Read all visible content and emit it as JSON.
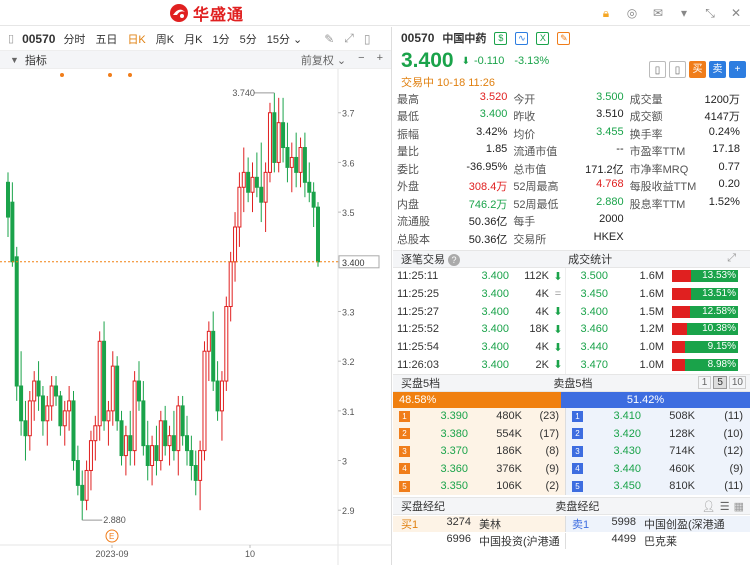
{
  "app": {
    "logo_text": "华盛通"
  },
  "chart_toolbar": {
    "code": "00570",
    "tabs": [
      "分时",
      "五日",
      "日K",
      "周K",
      "月K",
      "1分",
      "5分"
    ],
    "active_tab": "日K",
    "interval": "15分 ⌄"
  },
  "indicator_bar": {
    "label": "指标",
    "adjust": "前复权 ⌄",
    "minus": "−",
    "plus": "+"
  },
  "chart_data": {
    "type": "candlestick",
    "title": "",
    "xlabel": "",
    "ylabel": "",
    "x_ticks": [
      "2023-09",
      "10"
    ],
    "y_ticks": [
      2.9,
      3.0,
      3.1,
      3.2,
      3.3,
      3.4,
      3.5,
      3.6,
      3.7
    ],
    "ylim": [
      2.83,
      3.78
    ],
    "high_label": "3.740",
    "low_label": "2.880",
    "current_label": "3.400",
    "event_marker": "E",
    "candles": [
      [
        3.56,
        3.58,
        3.45,
        3.49
      ],
      [
        3.52,
        3.56,
        3.39,
        3.4
      ],
      [
        3.41,
        3.43,
        3.12,
        3.15
      ],
      [
        3.15,
        3.22,
        3.05,
        3.08
      ],
      [
        3.08,
        3.12,
        3.0,
        3.05
      ],
      [
        3.05,
        3.14,
        3.02,
        3.12
      ],
      [
        3.12,
        3.18,
        3.08,
        3.16
      ],
      [
        3.16,
        3.2,
        3.1,
        3.13
      ],
      [
        3.13,
        3.15,
        3.05,
        3.08
      ],
      [
        3.08,
        3.13,
        3.03,
        3.11
      ],
      [
        3.11,
        3.17,
        3.08,
        3.15
      ],
      [
        3.15,
        3.17,
        3.11,
        3.13
      ],
      [
        3.13,
        3.14,
        3.05,
        3.07
      ],
      [
        3.07,
        3.12,
        3.03,
        3.1
      ],
      [
        3.1,
        3.15,
        3.06,
        3.12
      ],
      [
        3.12,
        3.14,
        2.98,
        3.0
      ],
      [
        3.0,
        3.03,
        2.93,
        2.95
      ],
      [
        2.95,
        2.98,
        2.88,
        2.92
      ],
      [
        2.92,
        3.0,
        2.9,
        2.98
      ],
      [
        2.98,
        3.06,
        2.94,
        3.04
      ],
      [
        3.04,
        3.09,
        3.0,
        3.07
      ],
      [
        3.07,
        3.26,
        3.04,
        3.24
      ],
      [
        3.24,
        3.28,
        3.06,
        3.08
      ],
      [
        3.08,
        3.12,
        3.03,
        3.1
      ],
      [
        3.1,
        3.22,
        3.07,
        3.19
      ],
      [
        3.19,
        3.21,
        3.06,
        3.08
      ],
      [
        3.08,
        3.1,
        2.99,
        3.01
      ],
      [
        3.01,
        3.07,
        2.97,
        3.05
      ],
      [
        3.05,
        3.1,
        2.99,
        3.02
      ],
      [
        3.02,
        3.18,
        2.99,
        3.16
      ],
      [
        3.16,
        3.2,
        3.1,
        3.12
      ],
      [
        3.12,
        3.16,
        3.01,
        3.03
      ],
      [
        3.03,
        3.08,
        2.96,
        2.99
      ],
      [
        2.99,
        3.05,
        2.95,
        3.03
      ],
      [
        3.03,
        3.07,
        2.97,
        3.0
      ],
      [
        3.0,
        3.1,
        2.98,
        3.08
      ],
      [
        3.08,
        3.11,
        3.01,
        3.03
      ],
      [
        3.03,
        3.07,
        2.99,
        3.05
      ],
      [
        3.05,
        3.1,
        3.0,
        3.02
      ],
      [
        3.02,
        3.13,
        2.97,
        3.11
      ],
      [
        3.11,
        3.13,
        3.03,
        3.05
      ],
      [
        3.05,
        3.09,
        2.99,
        3.02
      ],
      [
        3.02,
        3.05,
        2.96,
        2.99
      ],
      [
        2.99,
        3.02,
        2.93,
        2.96
      ],
      [
        2.96,
        3.04,
        2.9,
        3.02
      ],
      [
        3.02,
        3.24,
        3.0,
        3.22
      ],
      [
        3.22,
        3.28,
        3.16,
        3.26
      ],
      [
        3.26,
        3.3,
        3.14,
        3.16
      ],
      [
        3.16,
        3.2,
        3.08,
        3.1
      ],
      [
        3.1,
        3.18,
        3.04,
        3.16
      ],
      [
        3.16,
        3.33,
        3.14,
        3.31
      ],
      [
        3.31,
        3.42,
        3.28,
        3.4
      ],
      [
        3.4,
        3.5,
        3.36,
        3.47
      ],
      [
        3.47,
        3.58,
        3.43,
        3.55
      ],
      [
        3.55,
        3.63,
        3.5,
        3.58
      ],
      [
        3.58,
        3.61,
        3.52,
        3.54
      ],
      [
        3.54,
        3.6,
        3.5,
        3.57
      ],
      [
        3.57,
        3.62,
        3.53,
        3.55
      ],
      [
        3.55,
        3.64,
        3.48,
        3.52
      ],
      [
        3.52,
        3.6,
        3.46,
        3.58
      ],
      [
        3.58,
        3.72,
        3.56,
        3.7
      ],
      [
        3.7,
        3.74,
        3.58,
        3.6
      ],
      [
        3.6,
        3.73,
        3.58,
        3.68
      ],
      [
        3.68,
        3.73,
        3.6,
        3.63
      ],
      [
        3.63,
        3.68,
        3.56,
        3.59
      ],
      [
        3.59,
        3.64,
        3.54,
        3.61
      ],
      [
        3.61,
        3.66,
        3.55,
        3.58
      ],
      [
        3.58,
        3.65,
        3.55,
        3.63
      ],
      [
        3.63,
        3.66,
        3.53,
        3.56
      ],
      [
        3.56,
        3.6,
        3.52,
        3.54
      ],
      [
        3.54,
        3.56,
        3.47,
        3.51
      ],
      [
        3.51,
        3.52,
        3.39,
        3.4
      ]
    ]
  },
  "quote": {
    "code": "00570",
    "name": "中国中药",
    "price": "3.400",
    "arrow": "⬇",
    "change": "-0.110",
    "change_pct": "-3.13%",
    "status": "交易中 10-18 11:26",
    "buttons": [
      "▯",
      "▯",
      "买",
      "卖",
      "+"
    ],
    "rows": [
      [
        [
          "最高",
          "3.520",
          "red"
        ],
        [
          "今开",
          "3.500",
          "green"
        ],
        [
          "成交量",
          "1200万",
          "blk"
        ]
      ],
      [
        [
          "最低",
          "3.400",
          "green"
        ],
        [
          "昨收",
          "3.510",
          "blk"
        ],
        [
          "成交额",
          "4147万",
          "blk"
        ]
      ],
      [
        [
          "振幅",
          "3.42%",
          "blk"
        ],
        [
          "均价",
          "3.455",
          "green"
        ],
        [
          "换手率",
          "0.24%",
          "blk"
        ]
      ],
      [
        [
          "量比",
          "1.85",
          "blk"
        ],
        [
          "流通市值",
          "--",
          "blk"
        ],
        [
          "市盈率TTM",
          "17.18",
          "blk"
        ]
      ],
      [
        [
          "委比",
          "-36.95%",
          "blk"
        ],
        [
          "总市值",
          "171.2亿",
          "blk"
        ],
        [
          "市净率MRQ",
          "0.77",
          "blk"
        ]
      ],
      [
        [
          "外盘",
          "308.4万",
          "red"
        ],
        [
          "52周最高",
          "4.768",
          "red"
        ],
        [
          "每股收益TTM",
          "0.20",
          "blk"
        ]
      ],
      [
        [
          "内盘",
          "746.2万",
          "green"
        ],
        [
          "52周最低",
          "2.880",
          "green"
        ],
        [
          "股息率TTM",
          "1.52%",
          "blk"
        ]
      ],
      [
        [
          "流通股",
          "50.36亿",
          "blk"
        ],
        [
          "每手",
          "2000",
          "blk"
        ],
        [
          "",
          "",
          " "
        ]
      ],
      [
        [
          "总股本",
          "50.36亿",
          "blk"
        ],
        [
          "交易所",
          "HKEX",
          "blk"
        ],
        [
          "",
          "",
          " "
        ]
      ]
    ]
  },
  "tick_trades": {
    "title": "逐笔交易",
    "rows": [
      [
        "11:25:11",
        "3.400",
        "112K",
        "⬇"
      ],
      [
        "11:25:25",
        "3.400",
        "4K",
        "="
      ],
      [
        "11:25:27",
        "3.400",
        "4K",
        "⬇"
      ],
      [
        "11:25:52",
        "3.400",
        "18K",
        "⬇"
      ],
      [
        "11:25:54",
        "3.400",
        "4K",
        "⬇"
      ],
      [
        "11:26:03",
        "3.400",
        "2K",
        "⬇"
      ]
    ]
  },
  "volume_stats": {
    "title": "成交统计",
    "rows": [
      [
        "3.500",
        "1.6M",
        "13.53%",
        0.1353
      ],
      [
        "3.450",
        "1.6M",
        "13.51%",
        0.1351
      ],
      [
        "3.400",
        "1.5M",
        "12.58%",
        0.1258
      ],
      [
        "3.460",
        "1.2M",
        "10.38%",
        0.1038
      ],
      [
        "3.440",
        "1.0M",
        "9.15%",
        0.0915
      ],
      [
        "3.470",
        "1.0M",
        "8.98%",
        0.0898
      ]
    ]
  },
  "order_book": {
    "bid_title": "买盘5档",
    "ask_title": "卖盘5档",
    "levels": [
      "1",
      "5",
      "10"
    ],
    "bid_pct": "48.58%",
    "ask_pct": "51.42%",
    "bids": [
      [
        "1",
        "3.390",
        "480K",
        "(23)"
      ],
      [
        "2",
        "3.380",
        "554K",
        "(17)"
      ],
      [
        "3",
        "3.370",
        "186K",
        "(8)"
      ],
      [
        "4",
        "3.360",
        "376K",
        "(9)"
      ],
      [
        "5",
        "3.350",
        "106K",
        "(2)"
      ]
    ],
    "asks": [
      [
        "1",
        "3.410",
        "508K",
        "(11)"
      ],
      [
        "2",
        "3.420",
        "128K",
        "(10)"
      ],
      [
        "3",
        "3.430",
        "714K",
        "(12)"
      ],
      [
        "4",
        "3.440",
        "460K",
        "(9)"
      ],
      [
        "5",
        "3.450",
        "810K",
        "(11)"
      ]
    ]
  },
  "brokers": {
    "bid_title": "买盘经纪",
    "ask_title": "卖盘经纪",
    "bids": [
      [
        "买1",
        "3274",
        "美林"
      ],
      [
        "",
        "6996",
        "中国投资(沪港通"
      ]
    ],
    "asks": [
      [
        "卖1",
        "5998",
        "中国创盈(深港通"
      ],
      [
        "",
        "4499",
        "巴克莱"
      ]
    ]
  }
}
